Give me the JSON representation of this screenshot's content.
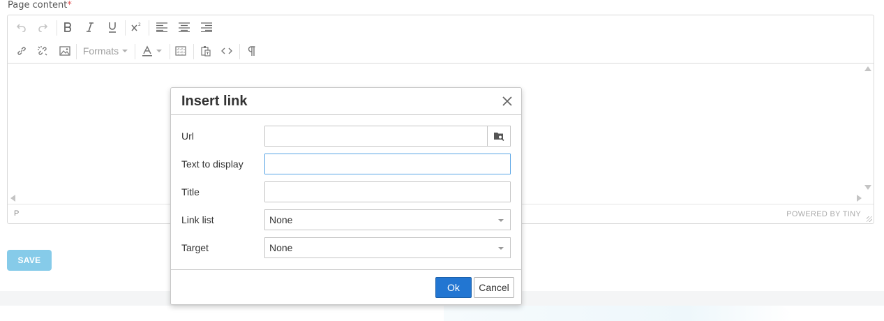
{
  "field": {
    "label": "Page content",
    "required_mark": "*"
  },
  "toolbar": {
    "formats_label": "Formats",
    "icons": [
      "undo-icon",
      "redo-icon",
      "bold-icon",
      "italic-icon",
      "underline-icon",
      "superscript-icon",
      "align-left-icon",
      "align-center-icon",
      "align-right-icon",
      "link-icon",
      "unlink-icon",
      "image-icon",
      "text-color-icon",
      "table-icon",
      "paste-icon",
      "code-icon",
      "paragraph-icon"
    ]
  },
  "statusbar": {
    "path": "P",
    "branding": "POWERED BY TINY"
  },
  "save": {
    "label": "SAVE"
  },
  "dialog": {
    "title": "Insert link",
    "fields": {
      "url": {
        "label": "Url",
        "value": ""
      },
      "text": {
        "label": "Text to display",
        "value": ""
      },
      "title": {
        "label": "Title",
        "value": ""
      },
      "link_list": {
        "label": "Link list",
        "value": "None"
      },
      "target": {
        "label": "Target",
        "value": "None"
      }
    },
    "ok_label": "Ok",
    "cancel_label": "Cancel"
  },
  "colors": {
    "primary": "#2276d2",
    "save_button": "#86cbe9",
    "required": "#e05252"
  }
}
